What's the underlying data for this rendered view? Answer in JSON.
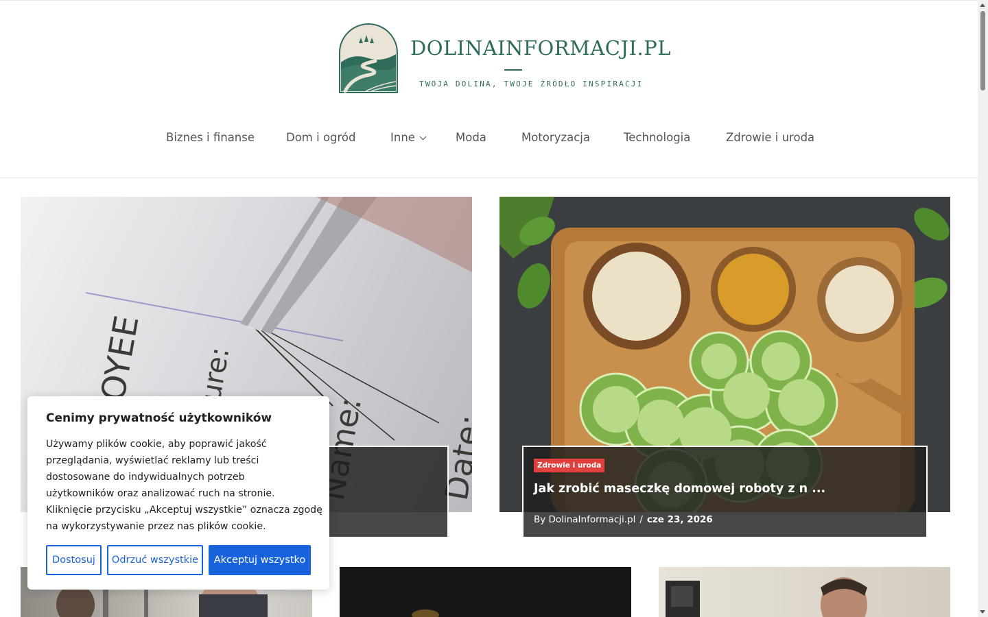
{
  "site": {
    "name": "DOLINAINFORMACJI.PL",
    "tagline": "TWOJA DOLINA, TWOJE ŹRÓDŁO INSPIRACJI",
    "brand_color": "#2e6b5a"
  },
  "nav": {
    "items": [
      {
        "label": "Biznes i finanse"
      },
      {
        "label": "Dom i ogród"
      },
      {
        "label": "Inne",
        "has_dropdown": true
      },
      {
        "label": "Moda"
      },
      {
        "label": "Motoryzacja"
      },
      {
        "label": "Technologia"
      },
      {
        "label": "Zdrowie i uroda"
      }
    ]
  },
  "featured": [
    {
      "category": "",
      "title": "",
      "author": "",
      "date": ""
    },
    {
      "category": "Zdrowie i uroda",
      "title": "Jak zrobić maseczkę domowej roboty z n ...",
      "author": "By DolinaInformacji.pl",
      "separator": "/",
      "date": "cze 23, 2026",
      "badge_color": "#e0413f"
    }
  ],
  "cookie_banner": {
    "title": "Cenimy prywatność użytkowników",
    "text_lines": [
      "Używamy plików cookie, aby poprawić jakość",
      "przeglądania, wyświetlać reklamy lub treści",
      "dostosowane do indywidualnych potrzeb",
      "użytkowników oraz analizować ruch na stronie.",
      "Kliknięcie przycisku „Akceptuj wszystkie” oznacza zgodę",
      "na wykorzystywanie przez nas plików cookie."
    ],
    "buttons": {
      "customize": "Dostosuj",
      "reject": "Odrzuć wszystkie",
      "accept": "Akceptuj wszystko"
    },
    "accent_color": "#1863dc"
  }
}
